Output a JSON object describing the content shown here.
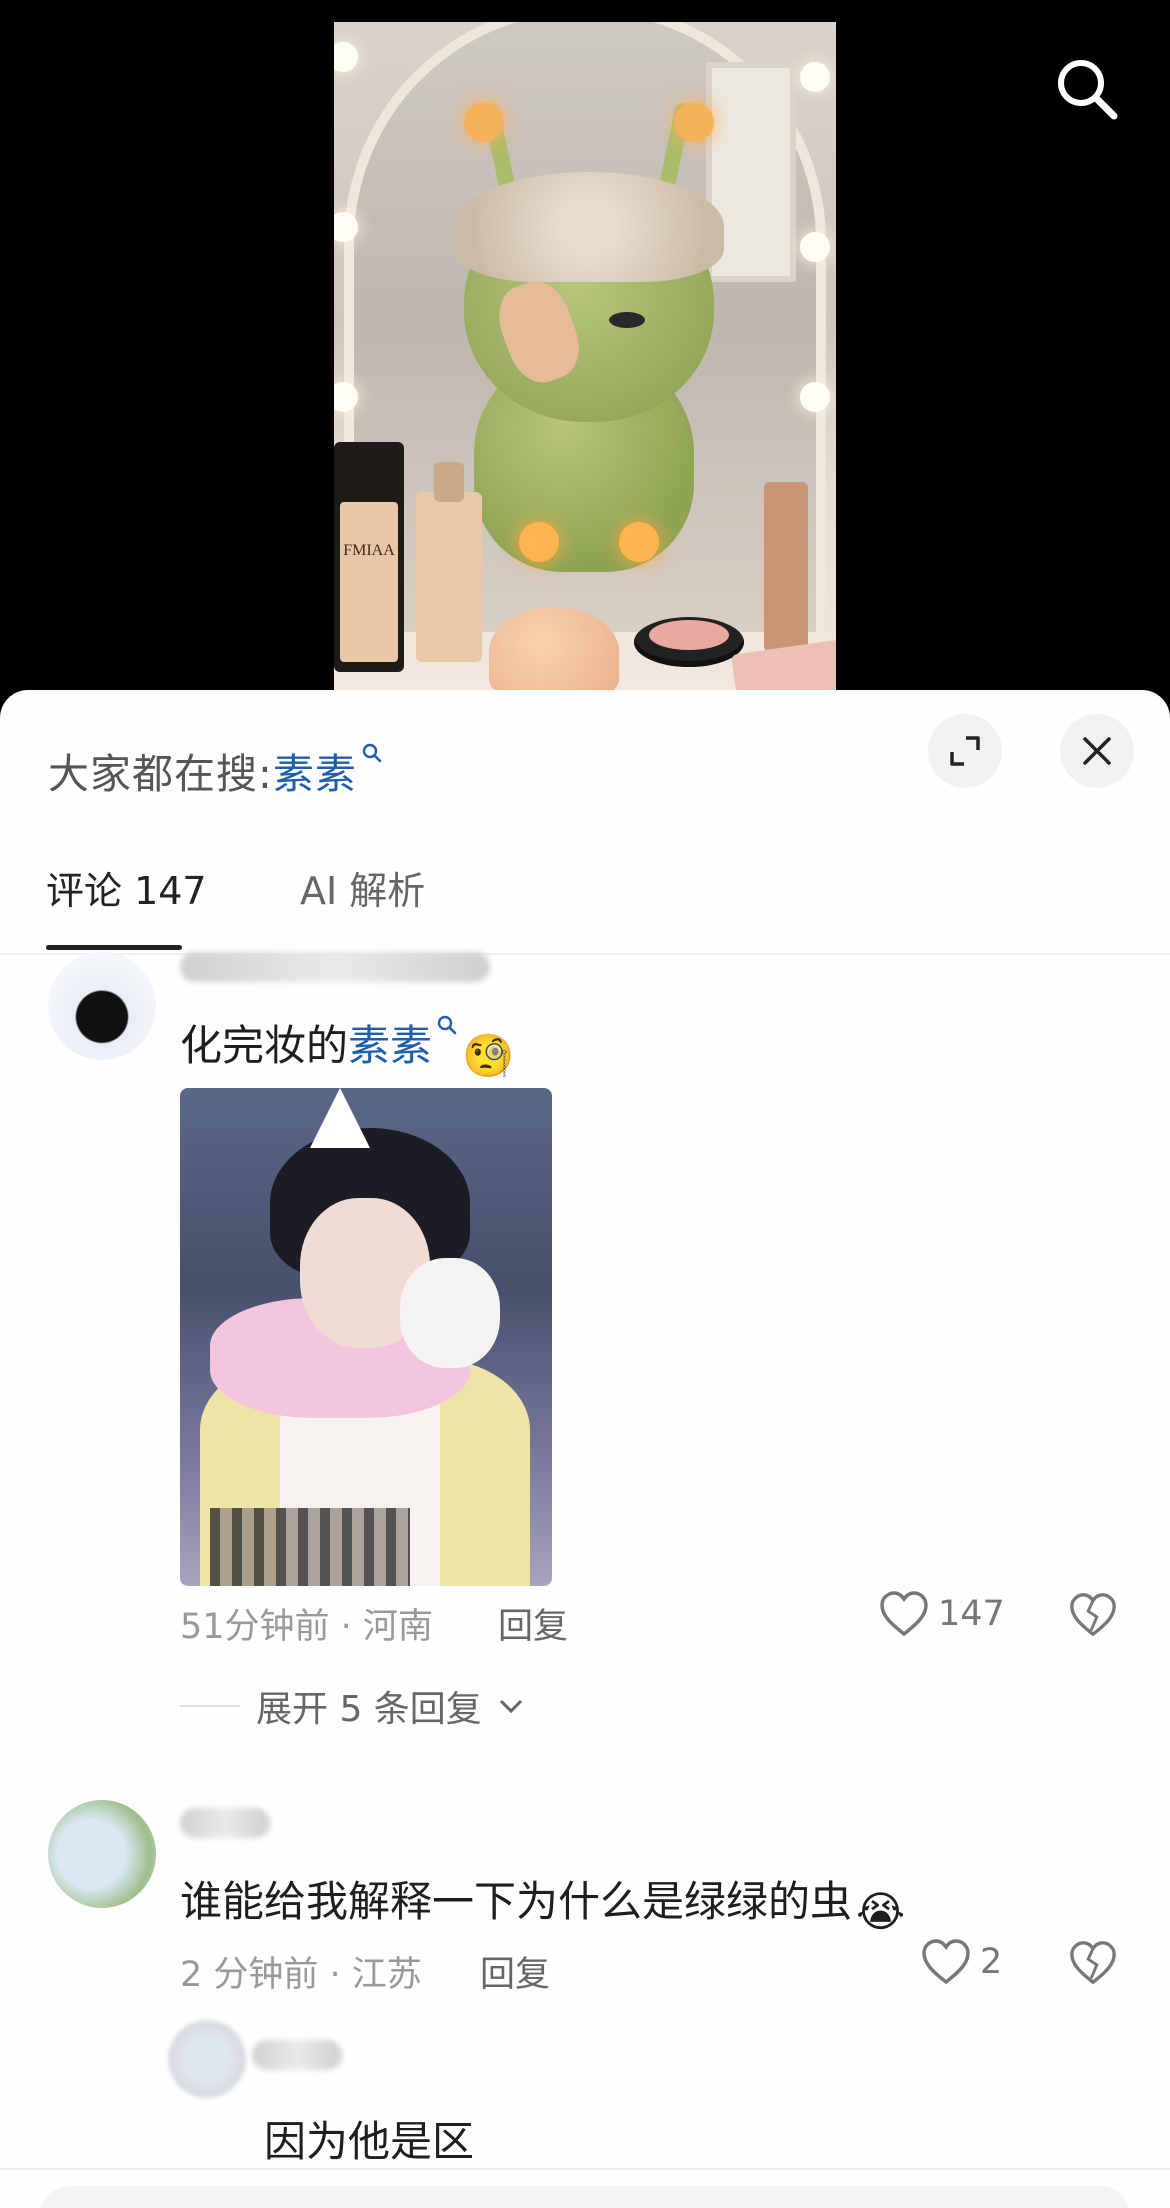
{
  "video": {
    "bottle_label": "FMIAA"
  },
  "trending": {
    "prefix": "大家都在搜:",
    "keyword": "素素"
  },
  "tabs": [
    {
      "label": "评论 147",
      "active": true
    },
    {
      "label": "AI 解析",
      "active": false
    }
  ],
  "comments": [
    {
      "text_before": "化完妆的",
      "keyword": "素素",
      "emoji": "🧐",
      "meta": "51分钟前 · 河南",
      "reply_label": "回复",
      "likes": "147",
      "expand_label": "展开 5 条回复"
    },
    {
      "text": "谁能给我解释一下为什么是绿绿的虫",
      "emoji": "😭",
      "meta": "2 分钟前 · 江苏",
      "reply_label": "回复",
      "likes": "2"
    }
  ],
  "reply": {
    "text": "因为他是区"
  },
  "colors": {
    "keyword": "#1f5ea8",
    "meta": "#999999",
    "background": "#fefefe"
  },
  "icons": [
    "search-icon",
    "expand-icon",
    "close-icon",
    "heart-icon",
    "broken-heart-icon",
    "chevron-down-icon"
  ]
}
